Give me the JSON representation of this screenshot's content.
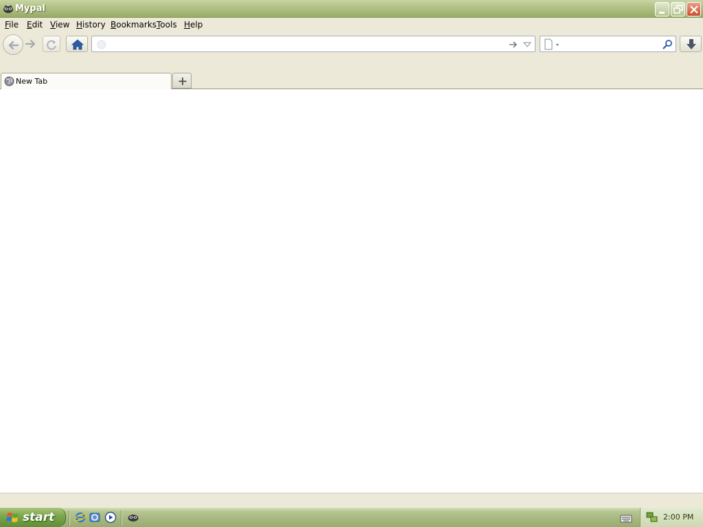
{
  "window": {
    "title": "Mypal"
  },
  "menu": [
    {
      "label": "File",
      "key": "F",
      "rest": "ile"
    },
    {
      "label": "Edit",
      "key": "E",
      "rest": "dit"
    },
    {
      "label": "View",
      "key": "V",
      "rest": "iew"
    },
    {
      "label": "History",
      "key": "H",
      "rest": "istory"
    },
    {
      "label": "Bookmarks",
      "key": "B",
      "rest": "ookmarks"
    },
    {
      "label": "Tools",
      "key": "T",
      "rest": "ools"
    },
    {
      "label": "Help",
      "key": "H",
      "rest": "elp"
    }
  ],
  "toolbar": {
    "url_value": "",
    "search_value": ""
  },
  "tabs": [
    {
      "label": "New Tab",
      "active": true
    }
  ],
  "taskbar": {
    "start_label": "start",
    "clock": "2:00 PM"
  },
  "theme": {
    "titlebar": "#b7c68c",
    "menubar": "#ece9d8",
    "taskbar": "#a5b77f",
    "start": "#7ba54c",
    "close": "#c94d2b"
  }
}
